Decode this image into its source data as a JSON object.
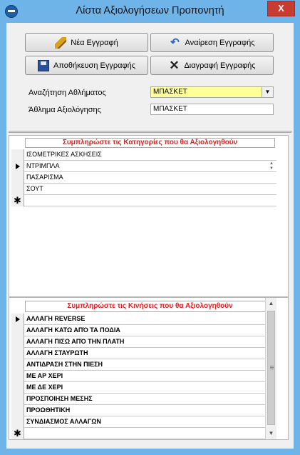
{
  "window": {
    "title": "Λίστα Αξιολογήσεων Προπονητή",
    "close_glyph": "X",
    "icon": "app-globe-icon"
  },
  "toolbar": {
    "new_record": "Νέα Εγγραφή",
    "undo_record": "Αναίρεση Εγγραφής",
    "save_record": "Αποθήκευση Εγγραφής",
    "delete_record": "Διαγραφή Εγγραφής",
    "icons": [
      "pencil-icon",
      "undo-icon",
      "save-disk-icon",
      "delete-x-icon"
    ]
  },
  "form": {
    "search_sport_label": "Αναζήτηση Αθλήματος",
    "search_sport_value": "ΜΠΑΣΚΕΤ",
    "sport_label": "Άθλημα Αξιολόγησης",
    "sport_value": "ΜΠΑΣΚΕΤ"
  },
  "categories": {
    "header": "Συμπληρώστε τις Κατηγορίες που θα Αξιολογηθούν",
    "rows": [
      "ΙΣΟΜΕΤΡΙΚΕΣ ΑΣΚΗΣΕΙΣ",
      "ΝΤΡΙΜΠΛΑ",
      "ΠΑΣΑΡΙΣΜΑ",
      "ΣΟΥΤ"
    ],
    "new_row_marker": "✱"
  },
  "movements": {
    "header": "Συμπληρώστε τις Κινήσεις που θα Αξιολογηθούν",
    "rows": [
      "ΑΛΛΑΓΗ REVERSE",
      "ΑΛΛΑΓΗ ΚΑΤΩ ΑΠΌ ΤΑ ΠΟΔΙΑ",
      "ΑΛΛΑΓΗ ΠΙΣΩ ΑΠΌ ΤΗΝ ΠΛΑΤΗ",
      "ΑΛΛΑΓΗ ΣΤΑΥΡΩΤΗ",
      "ΑΝΤΙΔΡΑΣΗ ΣΤΗΝ ΠΙΕΣΗ",
      "ΜΕ ΑΡ ΧΕΡΙ",
      "ΜΕ ΔΕ ΧΕΡΙ",
      "ΠΡΟΣΠΟΙΗΣΗ ΜΕΣΗΣ",
      "ΠΡΟΩΘΗΤΙΚΗ",
      "ΣΥΝΔΙΑΣΜΟΣ ΑΛΛΑΓΩΝ"
    ],
    "new_row_marker": "✱"
  },
  "colors": {
    "title_bar": "#6fb4e8",
    "close_button": "#c83b30",
    "combo_highlight": "#ffff99",
    "subform_header_text": "#e02020"
  }
}
